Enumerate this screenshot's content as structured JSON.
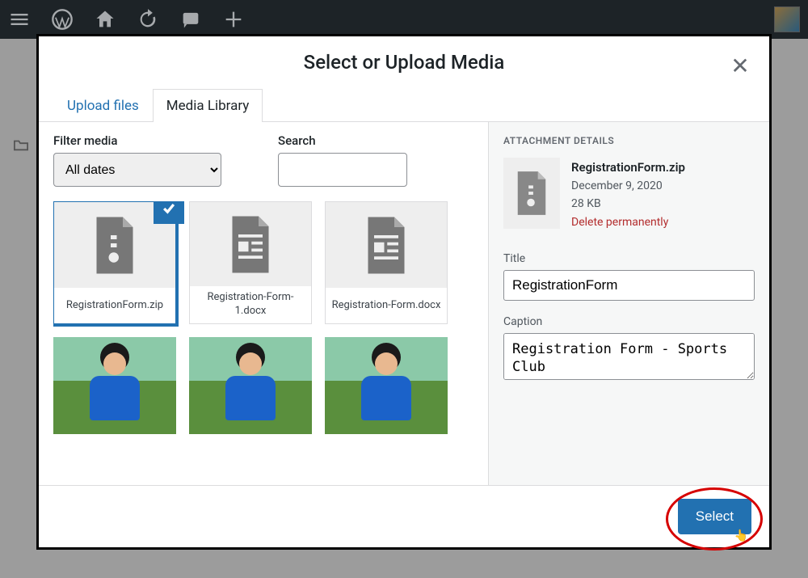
{
  "modal": {
    "title": "Select or Upload Media",
    "tabs": {
      "upload": "Upload files",
      "library": "Media Library"
    },
    "filter": {
      "label": "Filter media",
      "value": "All dates"
    },
    "search": {
      "label": "Search",
      "value": ""
    },
    "footer": {
      "select": "Select"
    }
  },
  "media": {
    "items": [
      {
        "label": "RegistrationForm.zip",
        "type": "zip"
      },
      {
        "label": "Registration-Form-1.docx",
        "type": "doc"
      },
      {
        "label": "Registration-Form.docx",
        "type": "doc"
      }
    ]
  },
  "details": {
    "heading": "ATTACHMENT DETAILS",
    "name": "RegistrationForm.zip",
    "date": "December 9, 2020",
    "size": "28 KB",
    "delete": "Delete permanently",
    "title_label": "Title",
    "title_value": "RegistrationForm",
    "caption_label": "Caption",
    "caption_value": "Registration Form - Sports Club"
  }
}
